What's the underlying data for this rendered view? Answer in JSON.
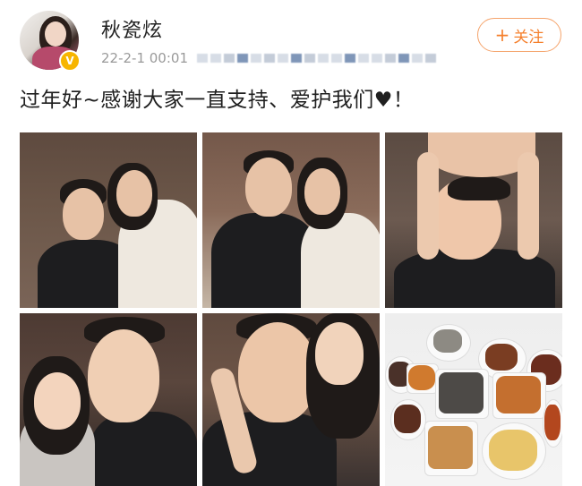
{
  "post": {
    "author": {
      "name": "秋瓷炫",
      "verified": true,
      "avatar_icon": "avatar-photo"
    },
    "timestamp": "22-2-1 00:01",
    "follow_button": {
      "label": "关注",
      "icon": "plus-icon"
    },
    "text": "过年好~感谢大家一直支持、爱护我们♥！",
    "photos": [
      {
        "icon": "photo-couple-hug"
      },
      {
        "icon": "photo-couple-sitting"
      },
      {
        "icon": "photo-hands-on-head"
      },
      {
        "icon": "photo-selfie"
      },
      {
        "icon": "photo-cheek-kiss"
      },
      {
        "icon": "photo-new-year-dishes"
      }
    ]
  },
  "colors": {
    "follow_accent": "#f57f2b",
    "verified_badge": "#f7b500",
    "meta_text": "#9a9a9a"
  }
}
